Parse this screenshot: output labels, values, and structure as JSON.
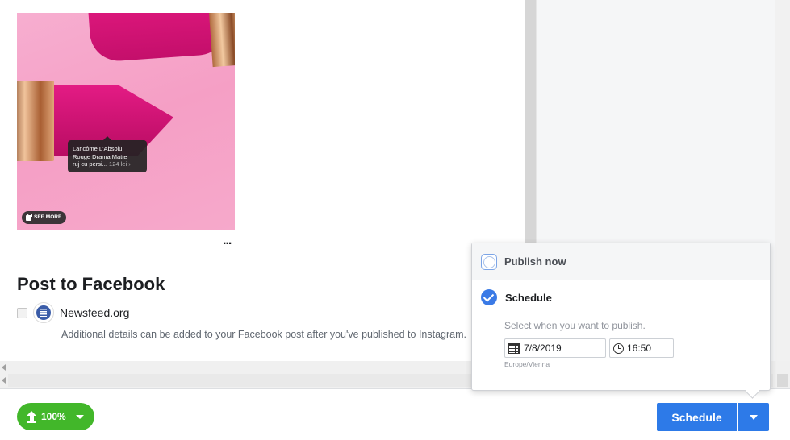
{
  "post_image": {
    "product_tag": {
      "line1": "Lancôme L'Absolu",
      "line2": "Rouge Drama Matte",
      "line3": "ruj cu persi...",
      "price": "124 lei ›"
    },
    "see_more_label": "SEE MORE",
    "more_menu_label": "..."
  },
  "facebook_section": {
    "title": "Post to Facebook",
    "page_name": "Newsfeed.org",
    "details": "Additional details can be added to your Facebook post after you've published to Instagram."
  },
  "footer": {
    "progress_label": "100%",
    "schedule_label": "Schedule"
  },
  "publish_popover": {
    "publish_now_label": "Publish now",
    "schedule_label": "Schedule",
    "hint": "Select when you want to publish.",
    "date": "7/8/2019",
    "time": "16:50",
    "timezone": "Europe/Vienna"
  },
  "colors": {
    "accent_blue": "#2d7ae8",
    "progress_green": "#42b72a"
  }
}
